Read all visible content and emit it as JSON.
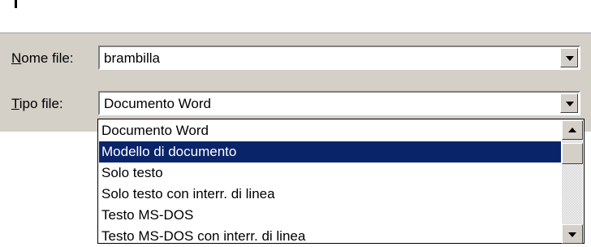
{
  "file_name": {
    "label_accel": "N",
    "label_rest": "ome file:",
    "value": "brambilla"
  },
  "file_type": {
    "label_accel": "T",
    "label_rest": "ipo file:",
    "value": "Documento Word"
  },
  "file_type_options": [
    {
      "label": "Documento Word",
      "selected": false
    },
    {
      "label": "Modello di documento",
      "selected": true
    },
    {
      "label": "Solo testo",
      "selected": false
    },
    {
      "label": "Solo testo con interr. di linea",
      "selected": false
    },
    {
      "label": "Testo MS-DOS",
      "selected": false
    },
    {
      "label": "Testo MS-DOS con interr. di linea",
      "selected": false
    }
  ],
  "colors": {
    "dialog_bg": "#d4d0c8",
    "selection_bg": "#0a246a",
    "selection_text": "#ffffff"
  },
  "icons": [
    "chevron-down-icon",
    "scroll-up-icon",
    "scroll-down-icon"
  ]
}
